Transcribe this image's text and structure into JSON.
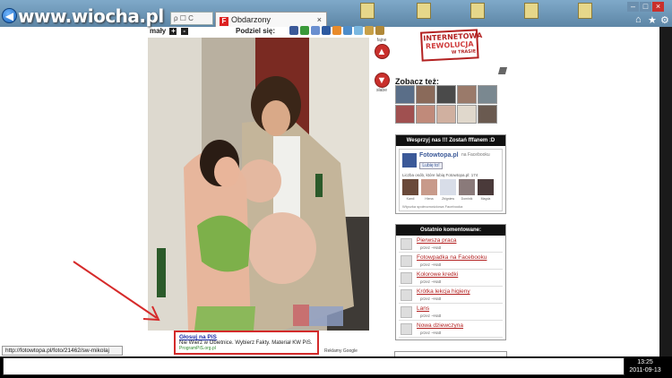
{
  "browser": {
    "watermark": "www.wiocha.pl",
    "search_box_text": "ρ ☐ C",
    "tab_title": "Obdarzony",
    "tab_close": "×",
    "back_glyph": "◀",
    "status_url": "http://fotowtopa.pl/foto/21462/sw-mikolaj"
  },
  "share": {
    "label": "Podziel się:",
    "size_label": "mały",
    "plus": "+",
    "minus": "-",
    "icons": [
      "facebook-icon",
      "gadu-icon",
      "blip-icon",
      "wykop-icon",
      "flaker-icon",
      "buzz-icon",
      "twitter-icon",
      "email-icon",
      "print-icon"
    ]
  },
  "vote": {
    "up_label": "fajne",
    "down_label": "słabe"
  },
  "logo": {
    "line1": "INTERNETOWA",
    "line2": "REWOLUCJA",
    "line3": "W TRASIE"
  },
  "see_also": {
    "title": "Zobacz też:"
  },
  "facebook": {
    "header": "Wesprzyj nas !!! Zostań fffanem :D",
    "page_name": "Fotowtopa.pl",
    "on_text": "na Facebooku",
    "like_label": "Lubię to!",
    "count_text": "Liczba osób, które lubią Fotowtopa.pl: 174",
    "faces": [
      "Kamil",
      "Hiena",
      "Zbigniew",
      "Dominik",
      "Magda"
    ],
    "plugin_text": "Wtyczka społecznościowa Facebooka"
  },
  "comments": {
    "header": "Ostatnio komentowane:",
    "items": [
      {
        "title": "Pierwsza praca",
        "author": "przez ~Hatt"
      },
      {
        "title": "Fotowpadka na Facebooku",
        "author": "przez ~Hatt"
      },
      {
        "title": "Kolorowe kredki",
        "author": "przez ~Hatt"
      },
      {
        "title": "Krótka lekcja higieny",
        "author": "przez ~Hatt"
      },
      {
        "title": "Lans",
        "author": "przez ~Hatt"
      },
      {
        "title": "Nowa dziewczyna",
        "author": "przez ~Hatt"
      }
    ]
  },
  "ad": {
    "title": "Głosuj na PiS",
    "text": "Nie Wierz w Obietnice. Wybierz Fakty. Materiał KW PiS.",
    "url": "ProgramPiS.org.pl",
    "google_label": "Reklamy Google"
  },
  "taskbar": {
    "time": "13:25",
    "date": "2011-09-13"
  },
  "colors": {
    "accent_red": "#c9302c",
    "fb_blue": "#3b5998"
  }
}
